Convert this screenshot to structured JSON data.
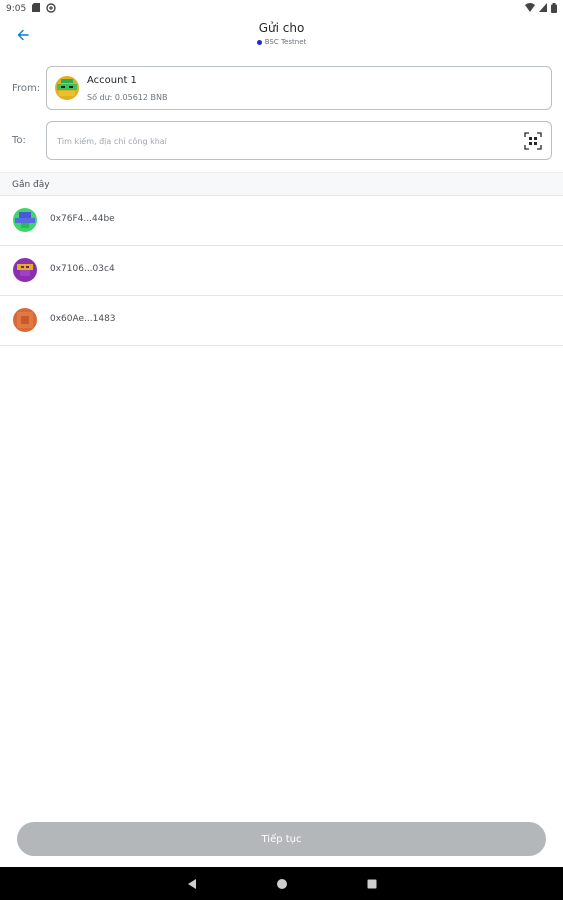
{
  "status_bar": {
    "time": "9:05",
    "icons_left": [
      "sd-card-icon",
      "data-saver-icon"
    ],
    "icons_right": [
      "wifi-icon",
      "signal-icon",
      "battery-icon"
    ]
  },
  "header": {
    "title": "Gửi cho",
    "network": "BSC Testnet",
    "network_dot_color": "#1e2bd8"
  },
  "from": {
    "label": "From:",
    "account_name": "Account 1",
    "balance": "Số dư: 0.05612 BNB"
  },
  "to": {
    "label": "To:",
    "placeholder": "Tìm kiếm, địa chỉ công khai",
    "value": ""
  },
  "recent": {
    "header": "Gần đây",
    "items": [
      {
        "address": "0x76F4...44be",
        "avatar_colors": [
          "#3ed66a",
          "#4a5ad6"
        ]
      },
      {
        "address": "0x7106...03c4",
        "avatar_colors": [
          "#8a2fb0",
          "#e0b020"
        ]
      },
      {
        "address": "0x60Ae...1483",
        "avatar_colors": [
          "#d66a3a",
          "#e07a40"
        ]
      }
    ]
  },
  "continue_button": {
    "label": "Tiếp tục",
    "disabled": true
  },
  "nav": {
    "buttons": [
      "back-icon",
      "home-icon",
      "recents-icon"
    ]
  }
}
